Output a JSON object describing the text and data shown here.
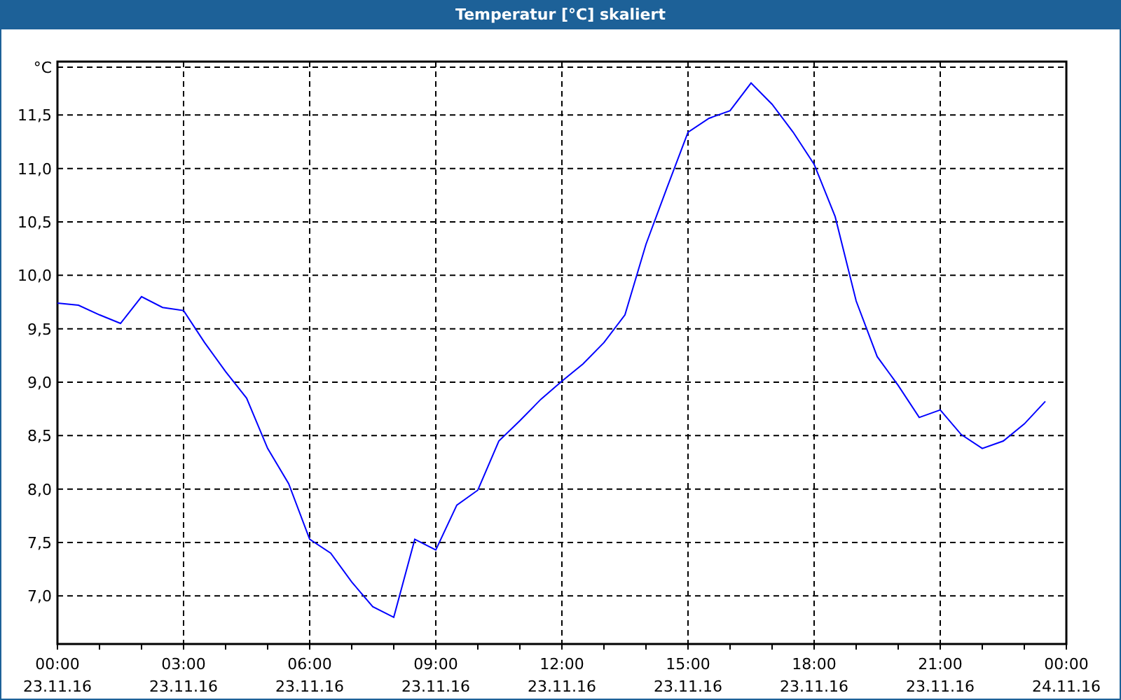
{
  "window": {
    "title": "Temperatur [°C] skaliert"
  },
  "chart": {
    "chart_data": {
      "type": "line",
      "grid": true,
      "ylabel": "°C",
      "ylim": [
        6.55,
        12.0
      ],
      "yticks": [
        {
          "value": 7.0,
          "label": "7,0"
        },
        {
          "value": 7.5,
          "label": "7,5"
        },
        {
          "value": 8.0,
          "label": "8,0"
        },
        {
          "value": 8.5,
          "label": "8,5"
        },
        {
          "value": 9.0,
          "label": "9,0"
        },
        {
          "value": 9.5,
          "label": "9,5"
        },
        {
          "value": 10.0,
          "label": "10,0"
        },
        {
          "value": 10.5,
          "label": "10,5"
        },
        {
          "value": 11.0,
          "label": "11,0"
        },
        {
          "value": 11.5,
          "label": "11,5"
        }
      ],
      "categories": [
        "00:00\n23.11.16",
        null,
        null,
        null,
        null,
        null,
        "03:00\n23.11.16",
        null,
        null,
        null,
        null,
        null,
        "06:00\n23.11.16",
        null,
        null,
        null,
        null,
        null,
        "09:00\n23.11.16",
        null,
        null,
        null,
        null,
        null,
        "12:00\n23.11.16",
        null,
        null,
        null,
        null,
        null,
        "15:00\n23.11.16",
        null,
        null,
        null,
        null,
        null,
        "18:00\n23.11.16",
        null,
        null,
        null,
        null,
        null,
        "21:00\n23.11.16",
        null,
        null,
        null,
        null,
        null,
        "00:00\n24.11.16"
      ],
      "series": [
        {
          "color": "#0000ff",
          "values": [
            9.74,
            9.72,
            9.63,
            9.55,
            9.8,
            9.7,
            9.67,
            9.37,
            9.1,
            8.85,
            8.38,
            8.05,
            7.53,
            7.4,
            7.13,
            6.9,
            6.8,
            7.53,
            7.43,
            7.85,
            7.99,
            8.45,
            8.64,
            8.84,
            9.01,
            9.17,
            9.37,
            9.63,
            10.29,
            10.82,
            11.34,
            11.47,
            11.54,
            11.8,
            11.6,
            11.34,
            11.04,
            10.55,
            9.76,
            9.24,
            8.97,
            8.67,
            8.74,
            8.51,
            8.38,
            8.45,
            8.61,
            8.82,
            null
          ]
        }
      ]
    }
  }
}
